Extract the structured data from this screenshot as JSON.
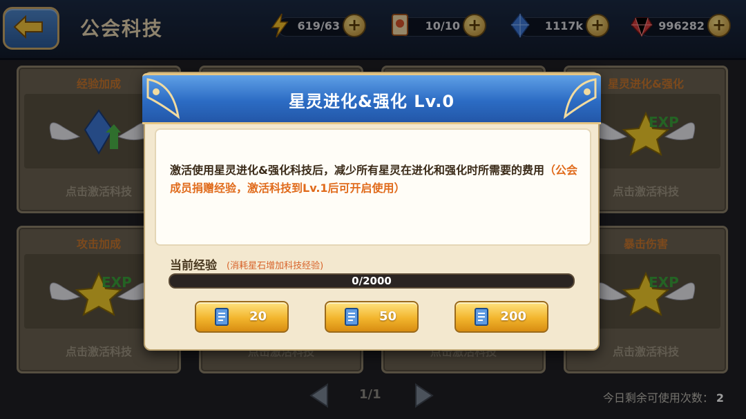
{
  "header": {
    "title": "公会科技",
    "resources": [
      {
        "name": "energy",
        "icon": "lightning-icon",
        "value": "619/63"
      },
      {
        "name": "tickets",
        "icon": "ticket-icon",
        "value": "10/10"
      },
      {
        "name": "crystals",
        "icon": "crystal-icon",
        "value": "1117k"
      },
      {
        "name": "gems",
        "icon": "ruby-icon",
        "value": "996282"
      }
    ]
  },
  "cards": [
    {
      "title": "经验加成",
      "footer": "点击激活科技",
      "icon": "crystal-wings-icon"
    },
    {
      "title": "",
      "footer": "",
      "icon": ""
    },
    {
      "title": "",
      "footer": "",
      "icon": ""
    },
    {
      "title": "星灵进化&强化",
      "footer": "点击激活科技",
      "icon": "exp-star-wings-icon"
    },
    {
      "title": "攻击加成",
      "footer": "点击激活科技",
      "icon": "exp-star-wings-icon"
    },
    {
      "title": "",
      "footer": "点击激活科技",
      "icon": ""
    },
    {
      "title": "",
      "footer": "点击激活科技",
      "icon": ""
    },
    {
      "title": "暴击伤害",
      "footer": "点击激活科技",
      "icon": "exp-star-wings-icon"
    }
  ],
  "pager": {
    "page": "1/1"
  },
  "remaining": {
    "label": "今日剩余可使用次数：",
    "value": "2"
  },
  "dialog": {
    "title": "星灵进化&强化 Lv.0",
    "description": "激活使用星灵进化&强化科技后，减少所有星灵在进化和强化时所需要的费用",
    "highlight": "（公会成员捐赠经验，激活科技到Lv.1后可开启使用）",
    "exp_label": "当前经验",
    "exp_hint": "(消耗星石增加科技经验)",
    "progress_text": "0/2000",
    "progress_fraction": 0,
    "buttons": [
      {
        "label": "20",
        "icon": "scroll-icon"
      },
      {
        "label": "50",
        "icon": "scroll-icon"
      },
      {
        "label": "200",
        "icon": "scroll-icon"
      }
    ]
  },
  "colors": {
    "accent_orange": "#e06b1c",
    "header_blue": "#2c6cc4",
    "gold": "#f2b52d"
  }
}
